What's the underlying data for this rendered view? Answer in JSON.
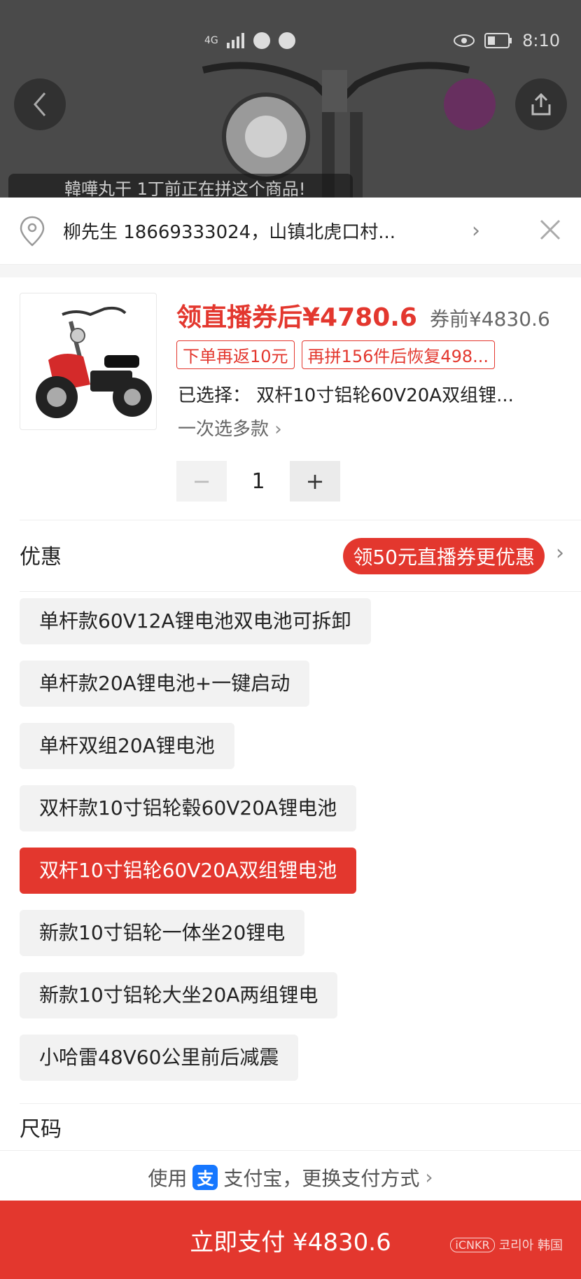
{
  "status_bar": {
    "network": "4G",
    "time": "8:10"
  },
  "live_banner": {
    "text": "韓嘩丸干 1丁前正在拼这个商品!"
  },
  "address": {
    "text": "柳先生 18669333024，山镇北虎口村..."
  },
  "product": {
    "price_after_coupon": "领直播券后¥4780.6",
    "price_before_coupon": "券前¥4830.6",
    "tags": [
      "下单再返10元",
      "再拼156件后恢复498..."
    ],
    "selected": "已选择： 双杆10寸铝轮60V20A双组锂...",
    "multi_select": "一次选多款",
    "quantity": "1",
    "minus": "−",
    "plus": "+"
  },
  "promo": {
    "label": "优惠",
    "pill": "领50元直播券更优惠"
  },
  "options": [
    {
      "label": "单杆款60V12A锂电池双电池可拆卸",
      "active": false
    },
    {
      "label": "单杆款20A锂电池+一键启动",
      "active": false
    },
    {
      "label": "单杆双组20A锂电池",
      "active": false
    },
    {
      "label": "双杆款10寸铝轮毂60V20A锂电池",
      "active": false
    },
    {
      "label": "双杆10寸铝轮60V20A双组锂电池",
      "active": true
    },
    {
      "label": "新款10寸铝轮一体坐20锂电",
      "active": false
    },
    {
      "label": "新款10寸铝轮大坐20A两组锂电",
      "active": false
    },
    {
      "label": "小哈雷48V60公里前后减震",
      "active": false
    }
  ],
  "size_label": "尺码",
  "payment": {
    "prefix": "使用",
    "alipay_glyph": "支",
    "suffix": "支付宝，更换支付方式"
  },
  "pay_button": "立即支付 ¥4830.6",
  "watermark": {
    "logo": "iCNKR",
    "text": "코리아 韩国",
    "url": "icnkr.com"
  },
  "colors": {
    "accent": "#e3372e",
    "alipay": "#1677ff"
  }
}
